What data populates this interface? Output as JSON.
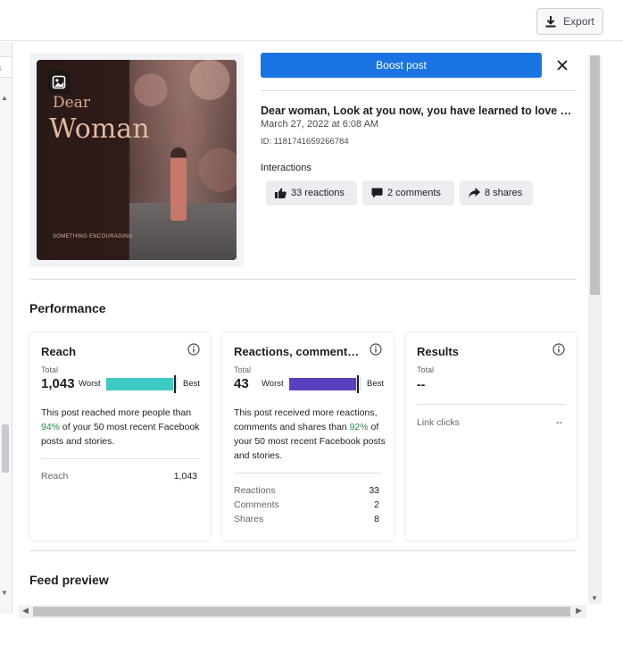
{
  "toolbar": {
    "export_label": "Export"
  },
  "left_strip": {
    "fragment": "es"
  },
  "post": {
    "image": {
      "line1": "Dear",
      "line2": "Woman",
      "tagline": "SOMETHING ENCOURAGING"
    },
    "boost_label": "Boost post",
    "title": "Dear woman, Look at you now, you have learned to love …",
    "date": "March 27, 2022 at 6:08 AM",
    "id": "ID: 1181741659266784",
    "interactions_label": "Interactions",
    "chips": {
      "reactions": "33 reactions",
      "comments": "2 comments",
      "shares": "8 shares"
    }
  },
  "performance": {
    "title": "Performance",
    "reach": {
      "title": "Reach",
      "total_label": "Total",
      "total": "1,043",
      "worst": "Worst",
      "best": "Best",
      "bar_fill_fraction": 0.94,
      "bar_color": "#3ecbc5",
      "desc_before": "This post reached more people than ",
      "desc_pct": "94%",
      "desc_after": " of your 50 most recent Facebook posts and stories.",
      "rows": [
        {
          "label": "Reach",
          "value": "1,043"
        }
      ]
    },
    "reactions": {
      "title": "Reactions, comment…",
      "total_label": "Total",
      "total": "43",
      "worst": "Worst",
      "best": "Best",
      "bar_fill_fraction": 0.92,
      "bar_color": "#5b3fbf",
      "desc_before": "This post received more reactions, comments and shares than ",
      "desc_pct": "92%",
      "desc_after": " of your 50 most recent Facebook posts and stories.",
      "rows": [
        {
          "label": "Reactions",
          "value": "33"
        },
        {
          "label": "Comments",
          "value": "2"
        },
        {
          "label": "Shares",
          "value": "8"
        }
      ]
    },
    "results": {
      "title": "Results",
      "total_label": "Total",
      "total": "--",
      "rows": [
        {
          "label": "Link clicks",
          "value": "--"
        }
      ]
    }
  },
  "feed_preview": {
    "title": "Feed preview"
  },
  "colors": {
    "accent": "#1b74e4",
    "positive": "#2a8a4a"
  }
}
